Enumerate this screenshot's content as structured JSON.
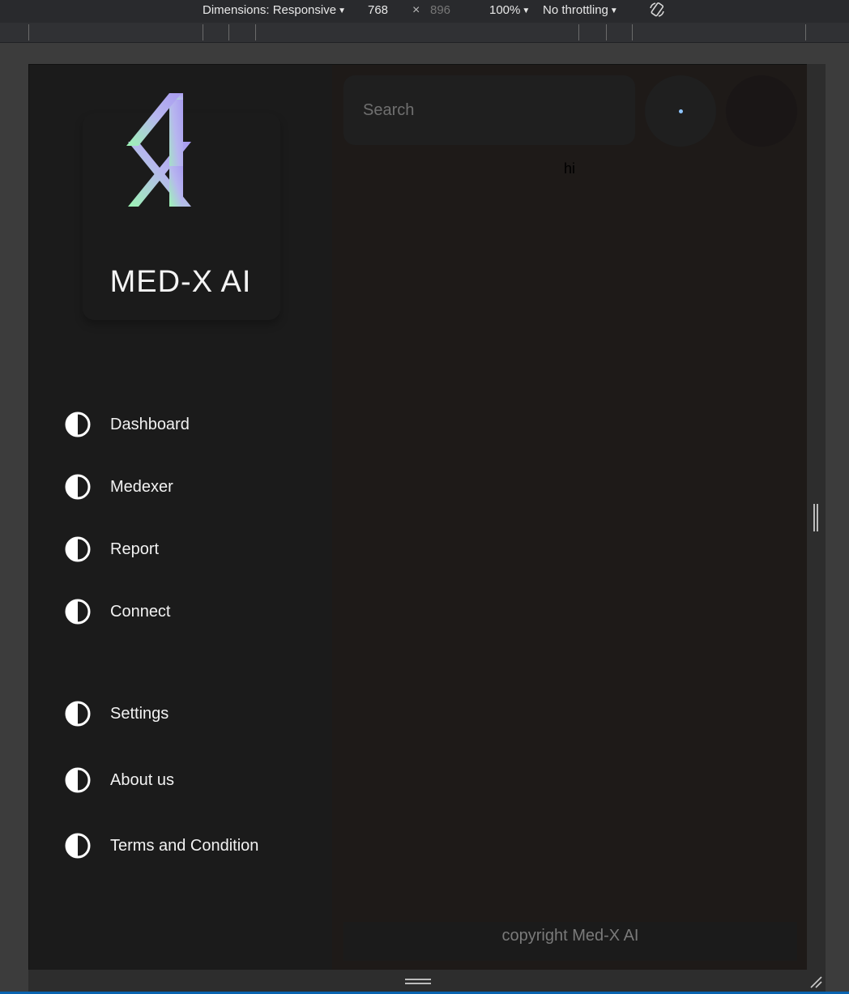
{
  "devtools": {
    "dimensions_label": "Dimensions: Responsive",
    "width": "768",
    "times": "×",
    "height": "896",
    "zoom": "100%",
    "throttling": "No throttling"
  },
  "app": {
    "brand": "MED-X AI",
    "nav": [
      {
        "label": "Dashboard"
      },
      {
        "label": "Medexer"
      },
      {
        "label": "Report"
      },
      {
        "label": "Connect"
      },
      {
        "label": "Settings"
      },
      {
        "label": "About us"
      },
      {
        "label": "Terms and Condition"
      }
    ],
    "search": {
      "placeholder": "Search",
      "value": ""
    },
    "content_text": "hi",
    "footer": "copyright Med-X AI"
  },
  "colors": {
    "sidebar_bg": "#1b1b1b",
    "main_bg": "#1e1a18",
    "logo_gradient": [
      "#9cf5b4",
      "#a99cf0"
    ],
    "accent_dot": "#8ec5ff"
  },
  "icons": {
    "nav_icon": "half-circle-icon",
    "rotate": "rotate-icon",
    "close": "times-icon"
  }
}
